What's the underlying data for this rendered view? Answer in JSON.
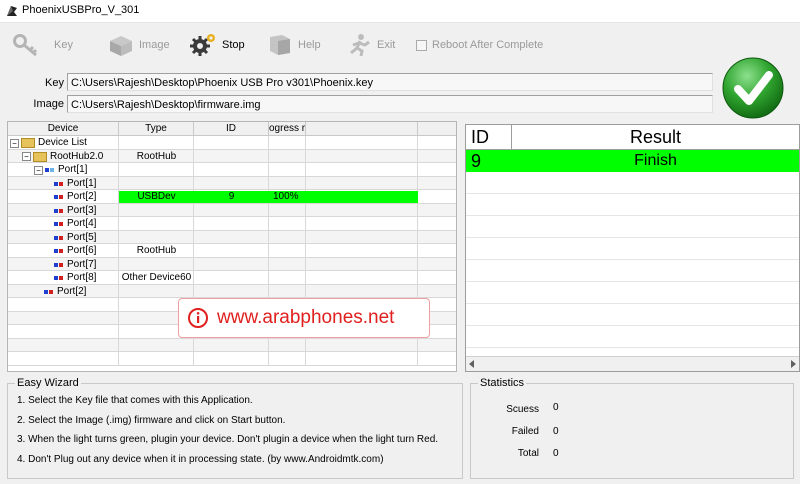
{
  "window": {
    "title": "PhoenixUSBPro_V_301"
  },
  "toolbar": {
    "key": "Key",
    "image": "Image",
    "stop": "Stop",
    "help": "Help",
    "exit": "Exit",
    "reboot": "Reboot After Complete"
  },
  "fields": {
    "key_label": "Key",
    "key_value": "C:\\Users\\Rajesh\\Desktop\\Phoenix USB Pro v301\\Phoenix.key",
    "image_label": "Image",
    "image_value": "C:\\Users\\Rajesh\\Desktop\\firmware.img"
  },
  "grid": {
    "headers": [
      "Device",
      "Type",
      "ID",
      "ogress r"
    ],
    "tree": {
      "device_list": "Device List",
      "roothub": "RootHub2.0",
      "port1": "Port[1]",
      "subports": [
        "Port[1]",
        "Port[2]",
        "Port[3]",
        "Port[4]",
        "Port[5]",
        "Port[6]",
        "Port[7]",
        "Port[8]"
      ],
      "port2": "Port[2]"
    },
    "rows": {
      "roothub_type": "RootHub",
      "usb_type": "USBDev",
      "usb_id": "9",
      "usb_progress": "100%",
      "port6_type": "RootHub",
      "port8_type": "Other Device60"
    },
    "watermark": "www.arabphones.net"
  },
  "result": {
    "headers": [
      "ID",
      "Result"
    ],
    "rows": [
      {
        "id": "9",
        "result": "Finish"
      }
    ]
  },
  "wizard": {
    "title": "Easy Wizard",
    "steps": [
      "1. Select the Key file that comes with this Application.",
      "2. Select the Image (.img) firmware and click on Start button.",
      "3. When the light turns green, plugin your device. Don't plugin a device when the light turn Red.",
      "4. Don't Plug out any device when it in processing state. (by www.Androidmtk.com)"
    ]
  },
  "stats": {
    "title": "Statistics",
    "success_label": "Scuess",
    "success_value": "0",
    "failed_label": "Failed",
    "failed_value": "0",
    "total_label": "Total",
    "total_value": "0"
  },
  "colors": {
    "highlight": "#00ff00",
    "status_light": "#2fa42f",
    "watermark": "#e0201f"
  }
}
